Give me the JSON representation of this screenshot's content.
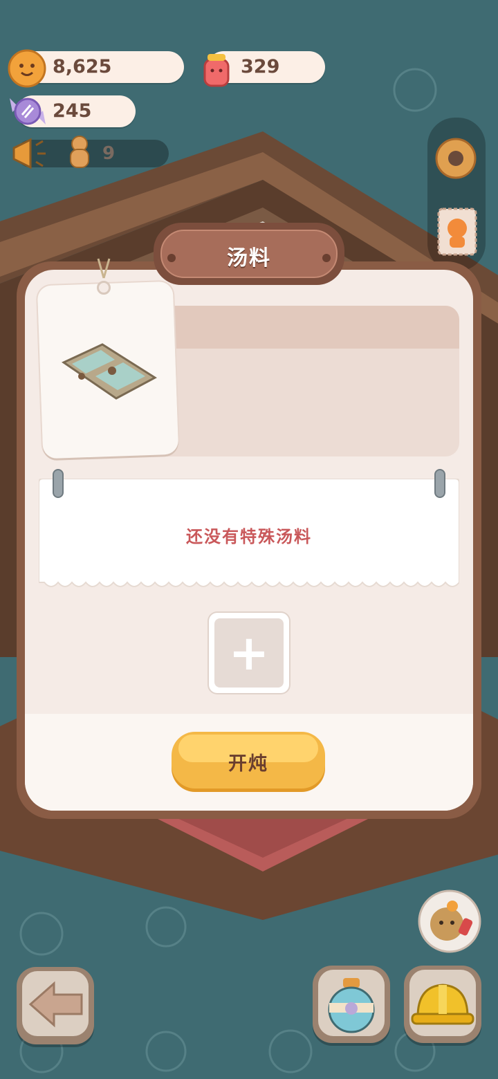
{
  "currency": {
    "cookies": "8,625",
    "jam": "329",
    "candy": "245",
    "gingerbread_count": "9"
  },
  "popup": {
    "title": "汤料",
    "empty_message": "还没有特殊汤料",
    "add_symbol": "+",
    "stew_button": "开炖"
  },
  "icons": {
    "cookie": "cookie-icon",
    "jam": "jam-jar-icon",
    "candy": "candy-icon",
    "megaphone": "megaphone-icon",
    "gingerbread": "gingerbread-icon",
    "settings": "gear-icon",
    "stamp": "stamp-icon",
    "pot": "soup-pot-tray-icon",
    "back": "back-arrow-icon",
    "potion": "potion-icon",
    "helmet": "hard-hat-icon",
    "character": "character-avatar-icon"
  },
  "colors": {
    "background": "#3f6b72",
    "popup": "#f5ebe6",
    "button": "#f4b847",
    "message": "#c9585a"
  }
}
